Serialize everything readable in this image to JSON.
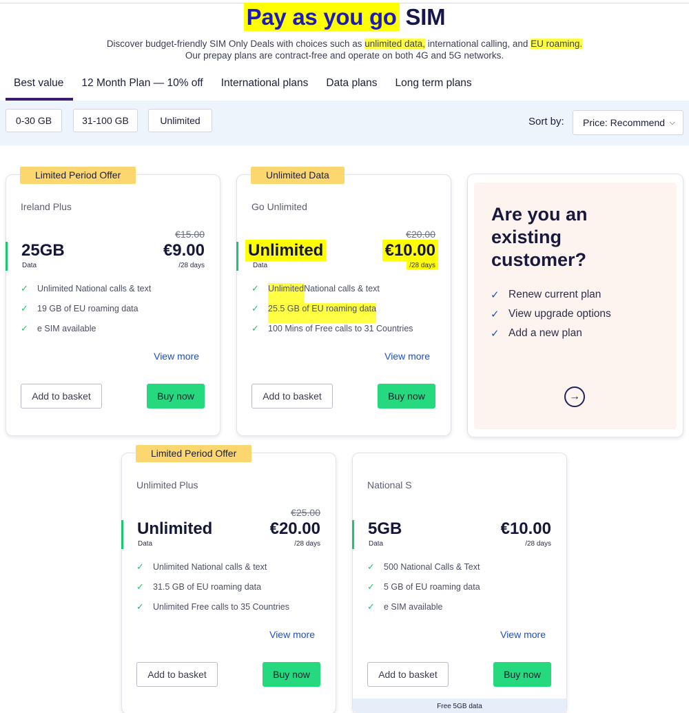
{
  "hero": {
    "title_part1": "Pay as you go",
    "title_part2": "SIM",
    "sub_line1_a": "Discover budget-friendly SIM Only Deals with choices such as ",
    "sub_line1_hl1": "unlimited data,",
    "sub_line1_b": " international calling, and ",
    "sub_line1_hl2": "EU roaming.",
    "sub_line2": "Our prepay plans are contract-free and operate on both 4G and 5G networks."
  },
  "tabs": [
    "Best value",
    "12 Month Plan — 10% off",
    "International plans",
    "Data plans",
    "Long term plans"
  ],
  "filters": [
    "0-30 GB",
    "31-100 GB",
    "Unlimited"
  ],
  "sort": {
    "label": "Sort by:",
    "selected": "Price: Recommend",
    "chevron_icon": "chevron-down-icon"
  },
  "common": {
    "data_label": "Data",
    "period": "/28 days",
    "view_more": "View more",
    "add_to_basket": "Add to basket",
    "buy_now": "Buy now"
  },
  "plans": [
    {
      "badge": "Limited Period Offer",
      "name": "Ireland Plus",
      "old_price": "€15.00",
      "data": "25GB",
      "price": "€9.00",
      "features": [
        "Unlimited National calls & text",
        "19 GB of EU roaming data",
        "e SIM available"
      ]
    },
    {
      "badge": "Unlimited Data",
      "name": "Go Unlimited",
      "old_price": "€20.00",
      "data": "Unlimited",
      "price": "€10.00",
      "features_hl0": "Unlimited",
      "features_rest0": " National calls & text",
      "features": [
        "Unlimited National calls & text",
        "25.5 GB of EU roaming data",
        "100 Mins of Free calls to 31 Countries"
      ]
    },
    {
      "badge": "Limited Period Offer",
      "name": "Unlimited Plus",
      "old_price": "€25.00",
      "data": "Unlimited",
      "price": "€20.00",
      "features": [
        "Unlimited National calls & text",
        "31.5 GB of EU roaming data",
        "Unlimited Free calls to 35 Countries"
      ]
    },
    {
      "name": "National S",
      "data": "5GB",
      "price": "€10.00",
      "features": [
        "500 National Calls & Text",
        "5 GB of EU roaming data",
        "e SIM available"
      ],
      "footer": "Free 5GB data"
    }
  ],
  "existing_customer": {
    "title": "Are you an existing customer?",
    "items": [
      "Renew current plan",
      "View upgrade options",
      "Add a new plan"
    ]
  },
  "colors": {
    "accent_green": "#26d97f",
    "tab_underline": "#3b1a78",
    "badge_yellow": "#fcd66e",
    "highlight": "#ffff00",
    "link_blue": "#1b4fc9"
  }
}
